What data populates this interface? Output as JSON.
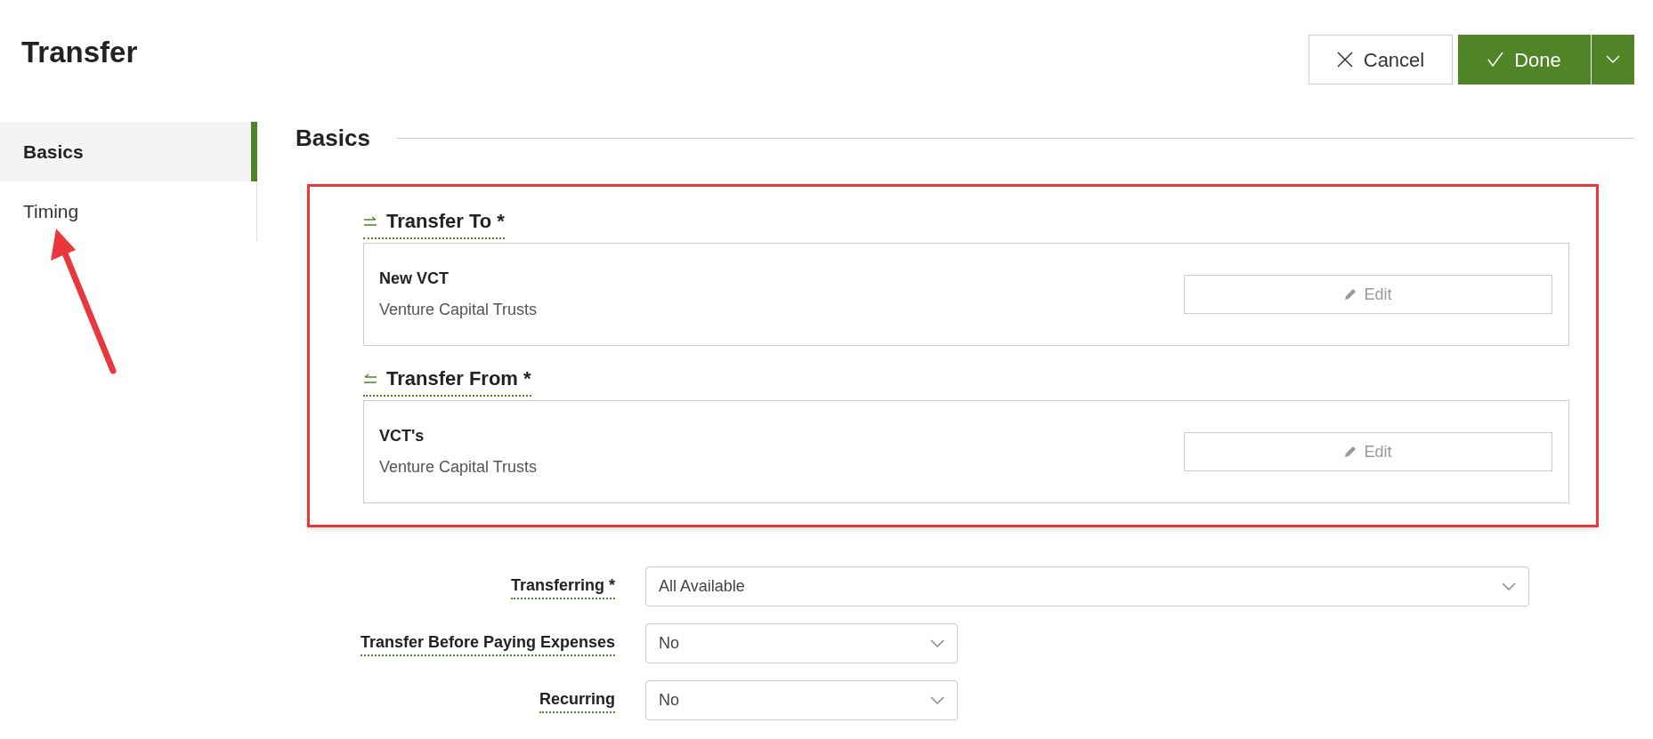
{
  "page": {
    "title": "Transfer"
  },
  "actions": {
    "cancel": "Cancel",
    "done": "Done"
  },
  "sidebar": {
    "items": [
      {
        "label": "Basics",
        "selected": true
      },
      {
        "label": "Timing",
        "selected": false
      }
    ]
  },
  "section": {
    "title": "Basics"
  },
  "transfers": [
    {
      "kind": "to",
      "label": "Transfer To *",
      "name": "New VCT",
      "type": "Venture Capital Trusts",
      "button": "Edit"
    },
    {
      "kind": "from",
      "label": "Transfer From *",
      "name": "VCT's",
      "type": "Venture Capital Trusts",
      "button": "Edit"
    }
  ],
  "fields": [
    {
      "label": "Transferring *",
      "value": "All Available",
      "wide": true
    },
    {
      "label": "Transfer Before Paying Expenses",
      "value": "No",
      "wide": false
    },
    {
      "label": "Recurring",
      "value": "No",
      "wide": false
    }
  ]
}
